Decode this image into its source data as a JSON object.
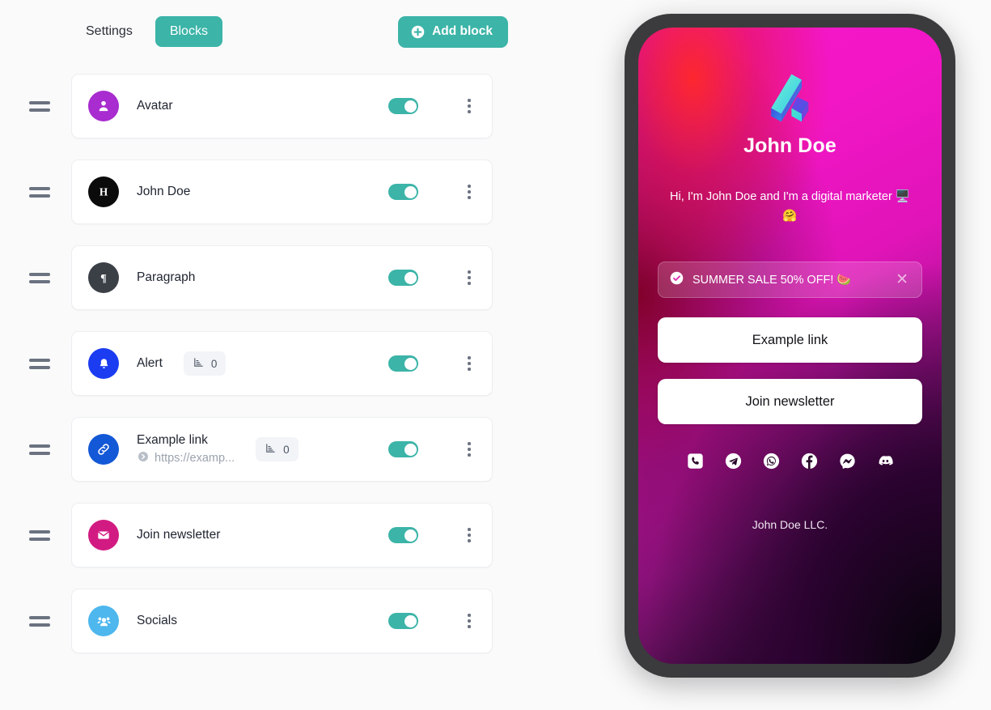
{
  "toolbar": {
    "tabs": [
      {
        "label": "Settings",
        "active": false
      },
      {
        "label": "Blocks",
        "active": true
      }
    ],
    "add_block_label": "Add block",
    "accent_color": "#3cb4a8"
  },
  "blocks": [
    {
      "title": "Avatar",
      "subtitle": "",
      "icon": "avatar-icon",
      "icon_color": "#a82ccf",
      "stat": null,
      "enabled": true
    },
    {
      "title": "John Doe",
      "subtitle": "",
      "icon": "heading-icon",
      "icon_color": "#0b0b0c",
      "stat": null,
      "enabled": true
    },
    {
      "title": "Paragraph",
      "subtitle": "",
      "icon": "paragraph-icon",
      "icon_color": "#3b3f46",
      "stat": null,
      "enabled": true
    },
    {
      "title": "Alert",
      "subtitle": "",
      "icon": "bell-icon",
      "icon_color": "#1b3cf0",
      "stat": "0",
      "enabled": true
    },
    {
      "title": "Example link",
      "subtitle": "https://examp...",
      "icon": "link-icon",
      "icon_color": "#1358d6",
      "stat": "0",
      "enabled": true
    },
    {
      "title": "Join newsletter",
      "subtitle": "",
      "icon": "envelope-icon",
      "icon_color": "#d21b82",
      "stat": null,
      "enabled": true
    },
    {
      "title": "Socials",
      "subtitle": "",
      "icon": "people-icon",
      "icon_color": "#4db7ee",
      "stat": null,
      "enabled": true
    }
  ],
  "preview": {
    "profile_name": "John Doe",
    "bio": "Hi, I'm John Doe and I'm a digital marketer 🖥️🤗",
    "alert": {
      "text": "SUMMER SALE 50% OFF! 🍉",
      "close_label": "✕"
    },
    "links": [
      {
        "label": "Example link"
      },
      {
        "label": "Join newsletter"
      }
    ],
    "socials": [
      {
        "name": "phone-icon"
      },
      {
        "name": "telegram-icon"
      },
      {
        "name": "whatsapp-icon"
      },
      {
        "name": "facebook-icon"
      },
      {
        "name": "messenger-icon"
      },
      {
        "name": "discord-icon"
      }
    ],
    "footer": "John Doe LLC."
  }
}
